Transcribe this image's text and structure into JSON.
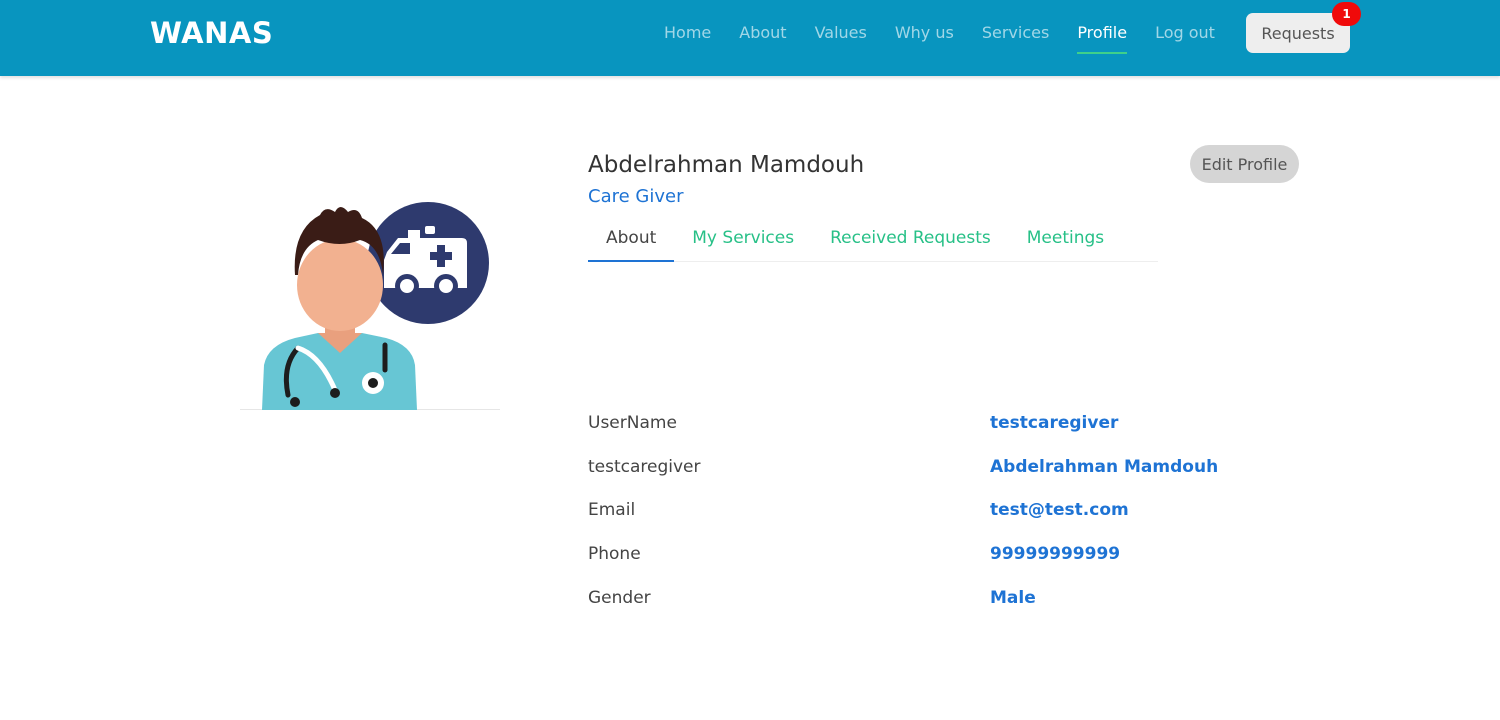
{
  "brand": "WANAS",
  "nav": {
    "items": [
      {
        "label": "Home",
        "active": false
      },
      {
        "label": "About",
        "active": false
      },
      {
        "label": "Values",
        "active": false
      },
      {
        "label": "Why us",
        "active": false
      },
      {
        "label": "Services",
        "active": false
      },
      {
        "label": "Profile",
        "active": true
      },
      {
        "label": "Log out",
        "active": false
      }
    ],
    "requests_label": "Requests",
    "requests_badge": "1"
  },
  "profile": {
    "name": "Abdelrahman Mamdouh",
    "role": "Care Giver",
    "edit_label": "Edit Profile",
    "avatar_icon": "caregiver-avatar-icon"
  },
  "tabs": [
    {
      "label": "About",
      "active": true
    },
    {
      "label": "My Services",
      "active": false
    },
    {
      "label": "Received Requests",
      "active": false
    },
    {
      "label": "Meetings",
      "active": false
    }
  ],
  "details": [
    {
      "label": "UserName",
      "value": "testcaregiver"
    },
    {
      "label": "testcaregiver",
      "value": "Abdelrahman Mamdouh"
    },
    {
      "label": "Email",
      "value": "test@test.com"
    },
    {
      "label": "Phone",
      "value": "99999999999"
    },
    {
      "label": "Gender",
      "value": "Male"
    }
  ],
  "colors": {
    "navbar": "#0895bf",
    "accent_blue": "#1e73d4",
    "accent_green": "#27c087",
    "badge_red": "#f00a0a"
  }
}
